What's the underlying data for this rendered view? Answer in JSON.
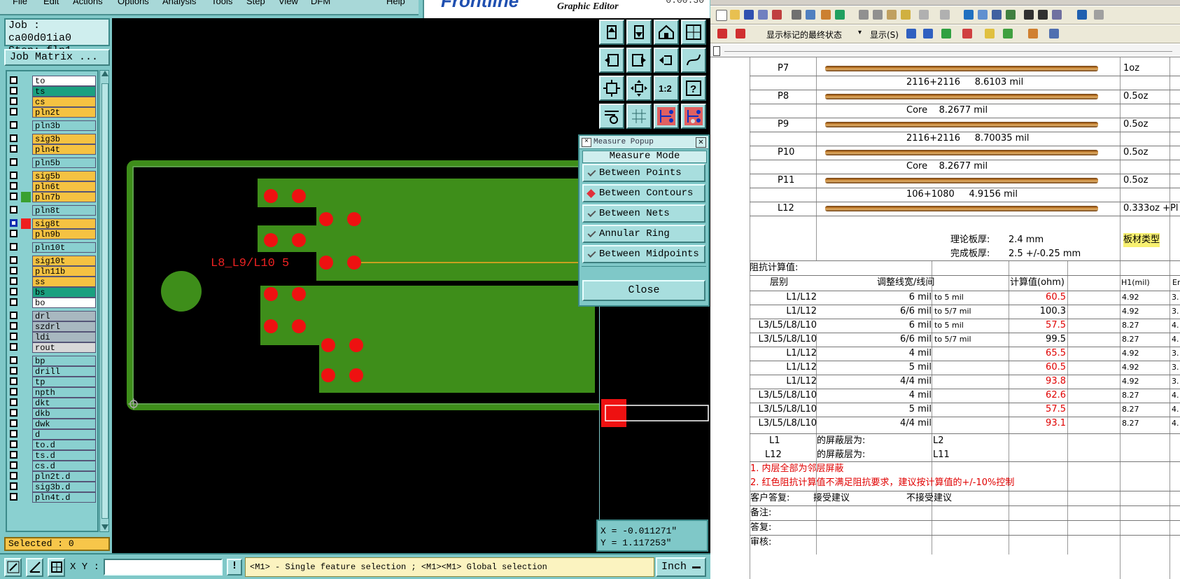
{
  "genesis": {
    "menu": [
      "File",
      "Edit",
      "Actions",
      "Options",
      "Analysis",
      "Tools",
      "Step",
      "View",
      "DFM",
      "Help"
    ],
    "brand": {
      "logo": "Frontline",
      "subtitle": "Graphic Editor",
      "corner": "0:00:30"
    },
    "job": "Job : ca00d01ia0",
    "step": "Step: flp1",
    "job_matrix_btn": "Job Matrix ...",
    "layers": [
      {
        "name": "to",
        "color": "#ffffff"
      },
      {
        "name": "ts",
        "color": "#1aa080"
      },
      {
        "name": "cs",
        "color": "#f5c242"
      },
      {
        "name": "pln2t",
        "color": "#f5c242"
      },
      {
        "name": "pln3b",
        "color": "#8ad0d0"
      },
      {
        "name": "sig3b",
        "color": "#f5c242"
      },
      {
        "name": "pln4t",
        "color": "#f5c242"
      },
      {
        "name": "pln5b",
        "color": "#8ad0d0"
      },
      {
        "name": "sig5b",
        "color": "#f5c242"
      },
      {
        "name": "pln6t",
        "color": "#f5c242"
      },
      {
        "name": "pln7b",
        "color": "#f5c242",
        "swatch": "#3aa030"
      },
      {
        "name": "pln8t",
        "color": "#8ad0d0"
      },
      {
        "name": "sig8t",
        "color": "#f5c242",
        "swatch": "#ee2020",
        "active": true
      },
      {
        "name": "pln9b",
        "color": "#f5c242"
      },
      {
        "name": "pln10t",
        "color": "#8ad0d0"
      },
      {
        "name": "sig10t",
        "color": "#f5c242"
      },
      {
        "name": "pln11b",
        "color": "#f5c242"
      },
      {
        "name": "ss",
        "color": "#f5c242"
      },
      {
        "name": "bs",
        "color": "#1aa080"
      },
      {
        "name": "bo",
        "color": "#ffffff"
      },
      {
        "name": "drl",
        "color": "#a8b8c0"
      },
      {
        "name": "szdrl",
        "color": "#a8b8c0"
      },
      {
        "name": "ldi",
        "color": "#a8b8c0"
      },
      {
        "name": "rout",
        "color": "#d8d8d8"
      },
      {
        "name": "bp",
        "color": "#8ad0d0"
      },
      {
        "name": "drill",
        "color": "#8ad0d0"
      },
      {
        "name": "tp",
        "color": "#8ad0d0"
      },
      {
        "name": "npth",
        "color": "#8ad0d0"
      },
      {
        "name": "dkt",
        "color": "#8ad0d0"
      },
      {
        "name": "dkb",
        "color": "#8ad0d0"
      },
      {
        "name": "dwk",
        "color": "#8ad0d0"
      },
      {
        "name": "d",
        "color": "#8ad0d0"
      },
      {
        "name": "to.d",
        "color": "#8ad0d0"
      },
      {
        "name": "ts.d",
        "color": "#8ad0d0"
      },
      {
        "name": "cs.d",
        "color": "#8ad0d0"
      },
      {
        "name": "pln2t.d",
        "color": "#8ad0d0"
      },
      {
        "name": "sig3b.d",
        "color": "#8ad0d0"
      },
      {
        "name": "pln4t.d",
        "color": "#8ad0d0"
      }
    ],
    "selected": "Selected : 0",
    "xy_label": "X Y :",
    "xy_value": "",
    "hint": "<M1> - Single feature selection ; <M1><M1> Global selection",
    "unit": "Inch",
    "canvas_label": "L8_L9/L10 5",
    "coords": {
      "x": "X = -0.011271\"",
      "y": "Y = 1.117253\""
    },
    "measure": {
      "title": "Measure Popup",
      "mode_label": "Measure Mode",
      "options": [
        {
          "label": "Between Points",
          "selected": false
        },
        {
          "label": "Between Contours",
          "selected": true
        },
        {
          "label": "Between Nets",
          "selected": false
        },
        {
          "label": "Annular Ring",
          "selected": false
        },
        {
          "label": "Between Midpoints",
          "selected": false
        }
      ],
      "close": "Close"
    },
    "colors": {
      "copper": "#3e8e1a",
      "pad": "#ee1111",
      "label": "#ee2222",
      "trace": "#c8a020"
    }
  },
  "word": {
    "toolbar_text1": "显示标记的最终状态",
    "toolbar_text2": "显示(S)",
    "stack": [
      {
        "name": "P7",
        "weight": "1oz"
      },
      {
        "name": "",
        "mid": "2116+2116     8.6103 mil"
      },
      {
        "name": "P8",
        "weight": "0.5oz"
      },
      {
        "name": "",
        "mid": "Core    8.2677 mil"
      },
      {
        "name": "P9",
        "weight": "0.5oz"
      },
      {
        "name": "",
        "mid": "2116+2116     8.70035 mil"
      },
      {
        "name": "P10",
        "weight": "0.5oz"
      },
      {
        "name": "",
        "mid": "Core    8.2677 mil"
      },
      {
        "name": "P11",
        "weight": "0.5oz"
      },
      {
        "name": "",
        "mid": "106+1080     4.9156 mil"
      },
      {
        "name": "L12",
        "weight": "0.333oz +Pl"
      }
    ],
    "theory_label": "理论板厚:",
    "theory_value": "2.4 mm",
    "board_type": "板材类型",
    "finish_label": "完成板厚:",
    "finish_value": "2.5 +/-0.25 mm",
    "imp_title": "阻抗计算值:",
    "headers": {
      "layer": "层别",
      "adjust": "调整线宽/线间",
      "calc": "计算值(ohm)",
      "h1": "H1(mil)",
      "er": "Er"
    },
    "imp_rows": [
      {
        "layer": "L1/L12",
        "w": "6 mil",
        "to": "to  5 mil",
        "val": "60.5",
        "h1": "4.92",
        "er": "3."
      },
      {
        "layer": "L1/L12",
        "w": "6/6 mil",
        "to": "to  5/7 mil",
        "val": "100.3",
        "h1": "4.92",
        "er": "3.",
        "black": true
      },
      {
        "layer": "L3/L5/L8/L10",
        "w": "6 mil",
        "to": "to  5 mil",
        "val": "57.5",
        "h1": "8.27",
        "er": "4."
      },
      {
        "layer": "L3/L5/L8/L10",
        "w": "6/6 mil",
        "to": "to  5/7 mil",
        "val": "99.5",
        "h1": "8.27",
        "er": "4.",
        "black": true
      },
      {
        "layer": "L1/L12",
        "w": "4 mil",
        "to": "",
        "val": "65.5",
        "h1": "4.92",
        "er": "3."
      },
      {
        "layer": "L1/L12",
        "w": "5 mil",
        "to": "",
        "val": "60.5",
        "h1": "4.92",
        "er": "3."
      },
      {
        "layer": "L1/L12",
        "w": "4/4 mil",
        "to": "",
        "val": "93.8",
        "h1": "4.92",
        "er": "3."
      },
      {
        "layer": "L3/L5/L8/L10",
        "w": "4 mil",
        "to": "",
        "val": "62.6",
        "h1": "8.27",
        "er": "4."
      },
      {
        "layer": "L3/L5/L8/L10",
        "w": "5 mil",
        "to": "",
        "val": "57.5",
        "h1": "8.27",
        "er": "4."
      },
      {
        "layer": "L3/L5/L8/L10",
        "w": "4/4 mil",
        "to": "",
        "val": "93.1",
        "h1": "8.27",
        "er": "4."
      }
    ],
    "shield1_layer": "L1",
    "shield1_label": "的屏蔽层为:",
    "shield1_value": "L2",
    "shield2_layer": "L12",
    "shield2_label": "的屏蔽层为:",
    "shield2_value": "L11",
    "note1": "1. 内层全部为邻层屏蔽",
    "note2": "2. 红色阻抗计算值不满足阻抗要求，建议按计算值的+/-10%控制",
    "customer_label": "客户答复:",
    "accept": "接受建议",
    "reject": "不接受建议",
    "remark": "备注:",
    "reply": "答复:",
    "review": "审核:"
  }
}
